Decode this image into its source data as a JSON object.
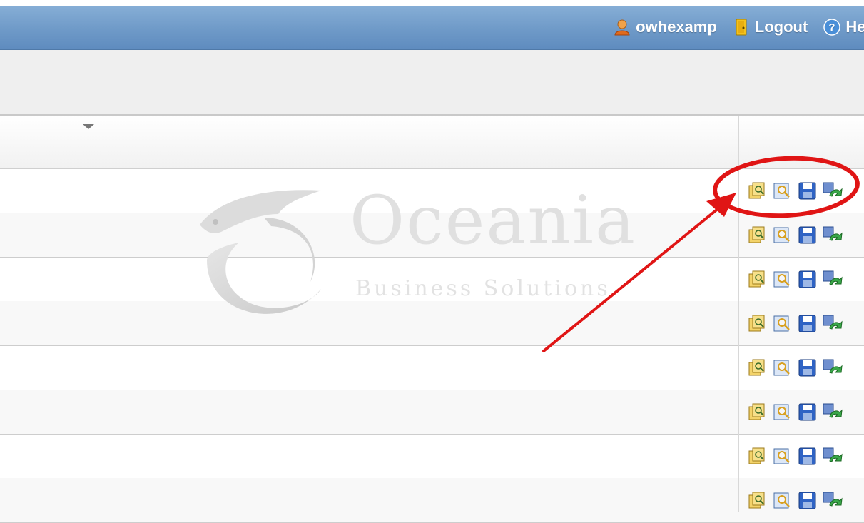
{
  "header": {
    "username": "owhexamp",
    "logout_label": "Logout",
    "help_label": "Help",
    "bar_color": "#6f9ac8"
  },
  "watermark": {
    "title": "Oceania",
    "subtitle": "Business Solutions"
  },
  "grid": {
    "row_count": 8,
    "row_actions": [
      {
        "name": "open-icon"
      },
      {
        "name": "view-icon"
      },
      {
        "name": "save-icon"
      },
      {
        "name": "transfer-icon"
      }
    ]
  },
  "annotation": {
    "color": "#e01515",
    "shape": "circle-and-arrow"
  }
}
